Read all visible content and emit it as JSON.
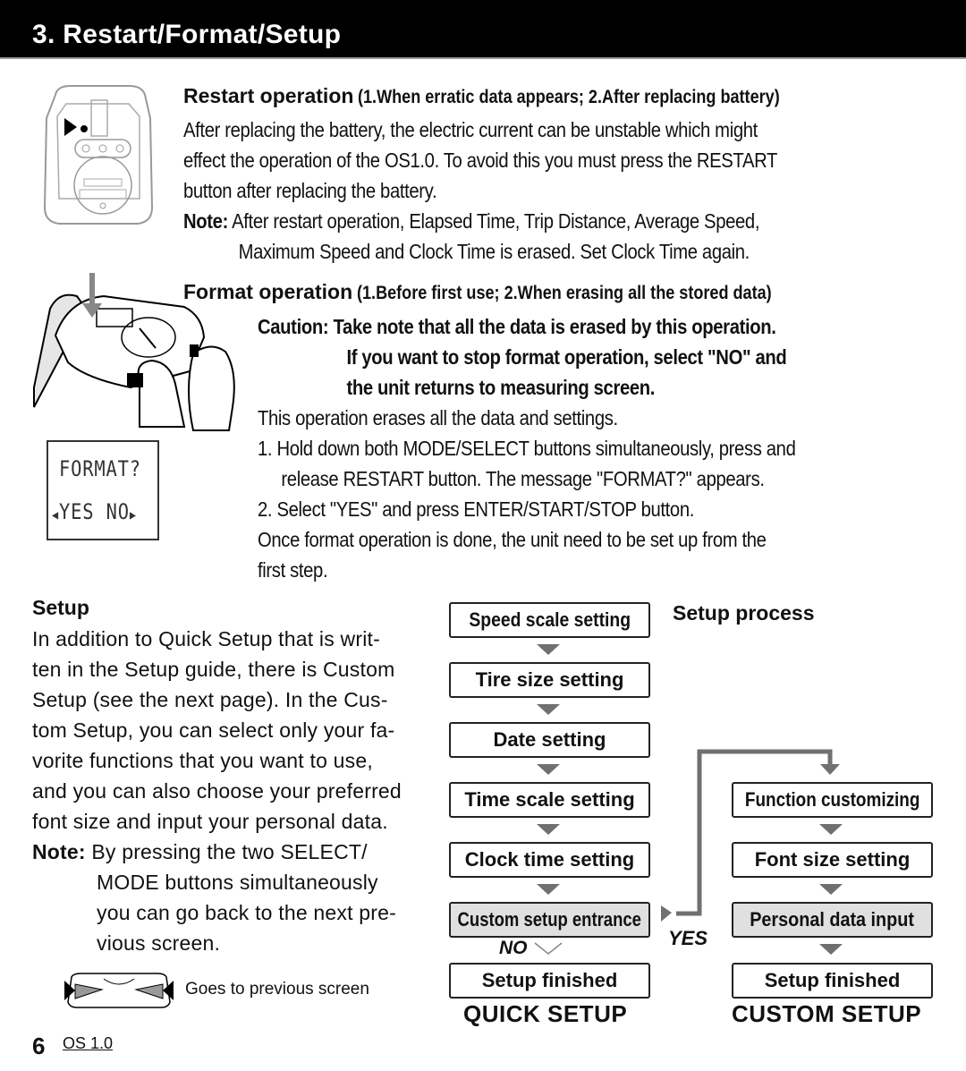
{
  "header": {
    "title": "3. Restart/Format/Setup"
  },
  "restart": {
    "title": "Restart operation",
    "subtitle": "(1.When erratic data appears; 2.After replacing battery)",
    "body_lines": [
      "After replacing the battery, the electric current can be unstable which might",
      "effect the operation of the OS1.0. To avoid this you must press the RESTART",
      "button after replacing the battery."
    ],
    "note_label": "Note:",
    "note_lines": [
      "After restart operation, Elapsed Time, Trip Distance, Average Speed,",
      "Maximum Speed and Clock Time is erased. Set Clock Time again."
    ]
  },
  "format": {
    "title": "Format operation",
    "subtitle": "(1.Before first use; 2.When erasing all the stored data)",
    "caution_label": "Caution:",
    "caution_lines": [
      "Take note that all the data is erased by this operation.",
      "If you want to stop format operation, select \"NO\" and",
      "the unit returns to measuring screen."
    ],
    "intro": "This operation erases all the data and settings.",
    "steps": [
      {
        "num": "1.",
        "lines": [
          "Hold down both MODE/SELECT buttons simultaneously, press and",
          "release RESTART button. The message \"FORMAT?\" appears."
        ]
      },
      {
        "num": "2.",
        "lines": [
          "Select \"YES\" and press ENTER/START/STOP button."
        ]
      }
    ],
    "outro_lines": [
      "Once format operation is done, the unit need to be set up from the",
      "first step."
    ],
    "lcd": {
      "line1": "FORMAT?",
      "yes": "YES",
      "no": "NO"
    }
  },
  "setup": {
    "title": "Setup",
    "body_lines": [
      "In addition to Quick Setup that is writ-",
      "ten in the Setup guide, there is Custom",
      "Setup (see the next page). In the Cus-",
      "tom Setup, you can select only your fa-",
      "vorite functions that you want to use,",
      "and you can also choose your preferred",
      "font size and input your personal data."
    ],
    "note_label": "Note:",
    "note_lines": [
      "By pressing the two SELECT/",
      "MODE buttons simultaneously",
      "you can go back to the next pre-",
      "vious screen."
    ],
    "device_caption": "Goes to previous screen"
  },
  "flow": {
    "title": "Setup process",
    "quick_steps": [
      "Speed scale setting",
      "Tire size setting",
      "Date setting",
      "Time scale setting",
      "Clock time setting",
      "Custom setup entrance",
      "Setup finished"
    ],
    "custom_steps": [
      "Function customizing",
      "Font size setting",
      "Personal data input",
      "Setup finished"
    ],
    "no_label": "NO",
    "yes_label": "YES",
    "quick_label": "QUICK SETUP",
    "custom_label": "CUSTOM SETUP",
    "arrow_color": "#707070",
    "highlight_color": "#e0e0e0"
  },
  "footer": {
    "page_number": "6",
    "product": "OS 1.0"
  }
}
